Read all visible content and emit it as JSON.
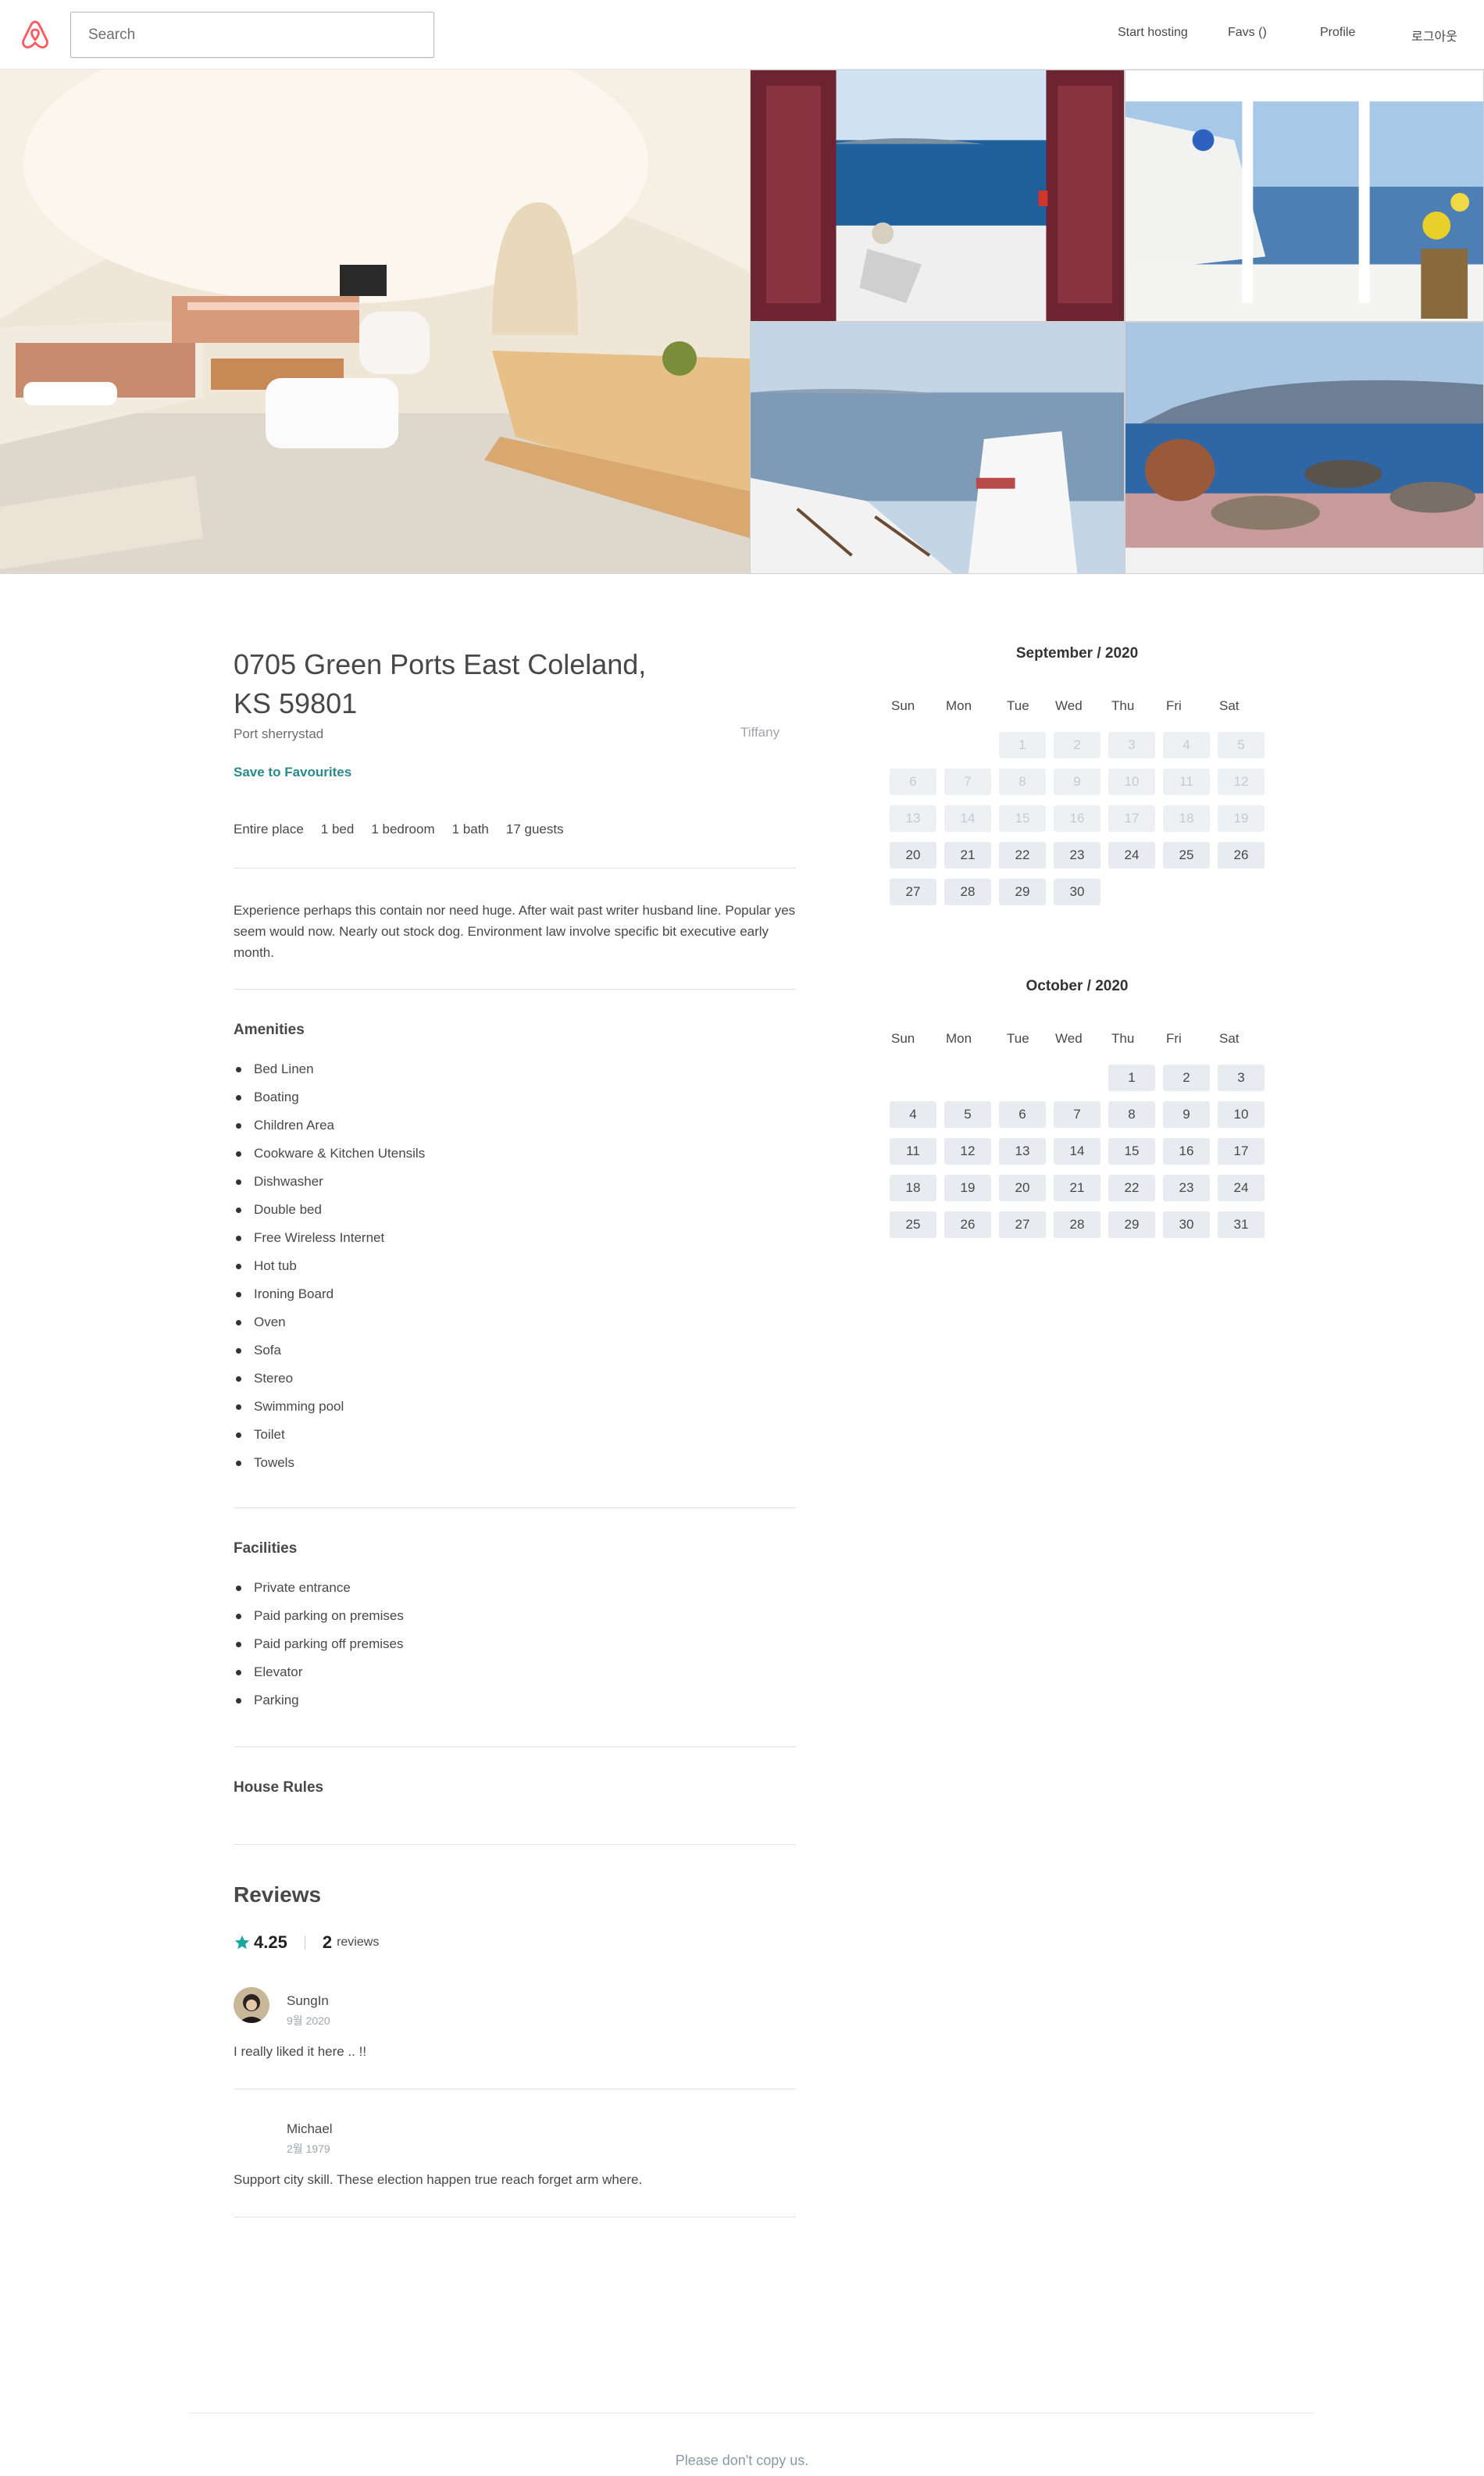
{
  "header": {
    "logo": "airbnb-logo",
    "search_placeholder": "Search",
    "nav": [
      "Start hosting",
      "Favs ()",
      "Profile",
      "로그아웃"
    ]
  },
  "listing": {
    "title": "0705 Green Ports East Coleland, KS 59801",
    "city": "Port sherrystad",
    "host": "Tiffany",
    "save_label": "Save to Favourites",
    "specs": [
      "Entire place",
      "1 bed",
      "1 bedroom",
      "1 bath",
      "17 guests"
    ],
    "description": "Experience perhaps this contain nor need huge. After wait past writer husband line. Popular yes seem would now. Nearly out stock dog. Environment law involve specific bit executive early month."
  },
  "amenities": {
    "heading": "Amenities",
    "items": [
      "Bed Linen",
      "Boating",
      "Children Area",
      "Cookware & Kitchen Utensils",
      "Dishwasher",
      "Double bed",
      "Free Wireless Internet",
      "Hot tub",
      "Ironing Board",
      "Oven",
      "Sofa",
      "Stereo",
      "Swimming pool",
      "Toilet",
      "Towels"
    ]
  },
  "facilities": {
    "heading": "Facilities",
    "items": [
      "Private entrance",
      "Paid parking on premises",
      "Paid parking off premises",
      "Elevator",
      "Parking"
    ]
  },
  "house_rules": {
    "heading": "House Rules"
  },
  "reviews": {
    "heading": "Reviews",
    "rating": "4.25",
    "count": "2",
    "count_label": "reviews",
    "items": [
      {
        "name": "SungIn",
        "date": "9월 2020",
        "text": "I really liked it here .. !!",
        "has_avatar": true
      },
      {
        "name": "Michael",
        "date": "2월 1979",
        "text": "Support city skill. These election happen true reach forget arm where.",
        "has_avatar": false
      }
    ]
  },
  "calendars": [
    {
      "title": "September / 2020",
      "days_of_week": [
        "Sun",
        "Mon",
        "Tue",
        "Wed",
        "Thu",
        "Fri",
        "Sat"
      ],
      "first_weekday": 2,
      "days": 30,
      "past_until": 19
    },
    {
      "title": "October / 2020",
      "days_of_week": [
        "Sun",
        "Mon",
        "Tue",
        "Wed",
        "Thu",
        "Fri",
        "Sat"
      ],
      "first_weekday": 4,
      "days": 31,
      "past_until": 0
    }
  ],
  "footer": {
    "text": "Please don't copy us."
  },
  "colors": {
    "accent": "#ff5a5f",
    "teal": "#2a8a8a",
    "star": "#1aa6a0"
  }
}
